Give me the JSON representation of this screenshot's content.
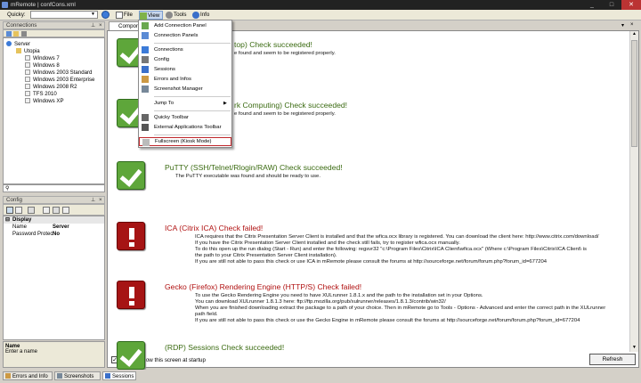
{
  "window": {
    "title": "mRemote | confCons.xml",
    "min": "_",
    "max": "□",
    "close": "✕"
  },
  "toolbar": {
    "quicky_label": "Quicky:",
    "menus": [
      "File",
      "View",
      "Tools",
      "Info"
    ]
  },
  "connections": {
    "header": "Connections",
    "tree": [
      {
        "label": "Server",
        "level": 0
      },
      {
        "label": "Utopia",
        "level": 1
      },
      {
        "label": "Windows 7",
        "level": 2
      },
      {
        "label": "Windows 8",
        "level": 2
      },
      {
        "label": "Windows 2003 Standard",
        "level": 2
      },
      {
        "label": "Windows 2003 Enterprise",
        "level": 2
      },
      {
        "label": "Windows 2008 R2",
        "level": 2
      },
      {
        "label": "TFS 2010",
        "level": 2
      },
      {
        "label": "Windows XP",
        "level": 2
      }
    ]
  },
  "config": {
    "header": "Config",
    "category": "Display",
    "rows": [
      {
        "key": "Name",
        "value": "Server"
      },
      {
        "key": "Password Protec",
        "value": "No"
      }
    ],
    "footer_title": "Name",
    "footer_desc": "Enter a name"
  },
  "doc_tab": "Compon",
  "view_menu": [
    {
      "label": "Add Connection Panel",
      "icon": "add-panel-icon"
    },
    {
      "label": "Connection Panels",
      "icon": "panels-icon"
    },
    {
      "sep": true
    },
    {
      "label": "Connections",
      "icon": "connections-icon"
    },
    {
      "label": "Config",
      "icon": "config-icon"
    },
    {
      "label": "Sessions",
      "icon": "sessions-icon"
    },
    {
      "label": "Errors and Infos",
      "icon": "errors-icon"
    },
    {
      "label": "Screenshot Manager",
      "icon": "screenshot-icon"
    },
    {
      "sep": true
    },
    {
      "label": "Jump To",
      "icon": "",
      "submenu": "▶"
    },
    {
      "sep": true
    },
    {
      "label": "Quicky Toolbar",
      "icon": "quicky-icon"
    },
    {
      "label": "External Applications Toolbar",
      "icon": "ext-apps-icon"
    },
    {
      "sep": true
    },
    {
      "label": "Fullscreen (Kiosk Mode)",
      "icon": "fullscreen-icon",
      "highlight": true
    }
  ],
  "checks": [
    {
      "status": "ok",
      "title": "top) Check succeeded!",
      "desc": "e found and seem to be registered properly."
    },
    {
      "status": "ok",
      "title": "rk Computing) Check succeeded!",
      "desc": "e found and seem to be registered properly."
    },
    {
      "status": "ok",
      "title": "PuTTY (SSH/Telnet/Rlogin/RAW) Check succeeded!",
      "desc": "The PuTTY executable was found and should be ready to use."
    },
    {
      "status": "fail",
      "title": "ICA (Citrix ICA) Check failed!",
      "desc": "ICA requires that the Citrix Presentation Server Client is installed and that the wfica.ocx library is registered. You can download the client here: http://www.citrix.com/download/\nIf you have the Citrix Presentation Server Client installed and the check still fails, try to register wfica.ocx manually.\nTo do this open up the run dialog (Start - Run) and enter the following: regsvr32 \"c:\\Program Files\\Citrix\\ICA Client\\wfica.ocx\" (Where c:\\Program Files\\Citrix\\ICA Client\\ is\nthe path to your Citrix Presentation Server Client installation).\nIf you are still not able to pass this check or use ICA in mRemote please consult the forums at http://sourceforge.net/forum/forum.php?forum_id=677204"
    },
    {
      "status": "fail",
      "title": "Gecko (Firefox) Rendering Engine (HTTP/S) Check failed!",
      "desc": "To use the Gecko Rendering Engine you need to have XULrunner 1.8.1.x and the path to the installation set in your Options.\nYou can download XULrunner 1.8.1.3 here: ftp://ftp.mozilla.org/pub/xulrunner/releases/1.8.1.3/contrib/win32/\nWhen you are finished downloading extract the package to a path of your choice. Then in mRemote go to Tools - Options - Advanced and enter the correct path in the XULrunner\npath field.\nIf you are still not able to pass this check or use the Gecko Engine in mRemote please consult the forums at http://sourceforge.net/forum/forum.php?forum_id=677204"
    },
    {
      "status": "ok",
      "title": "(RDP) Sessions Check succeeded!",
      "desc": ""
    }
  ],
  "footer": {
    "always_show": "Always show this screen at startup",
    "refresh": "Refresh"
  },
  "bottom_tabs": [
    "Errors and Info",
    "Screenshots",
    "Sessions"
  ]
}
